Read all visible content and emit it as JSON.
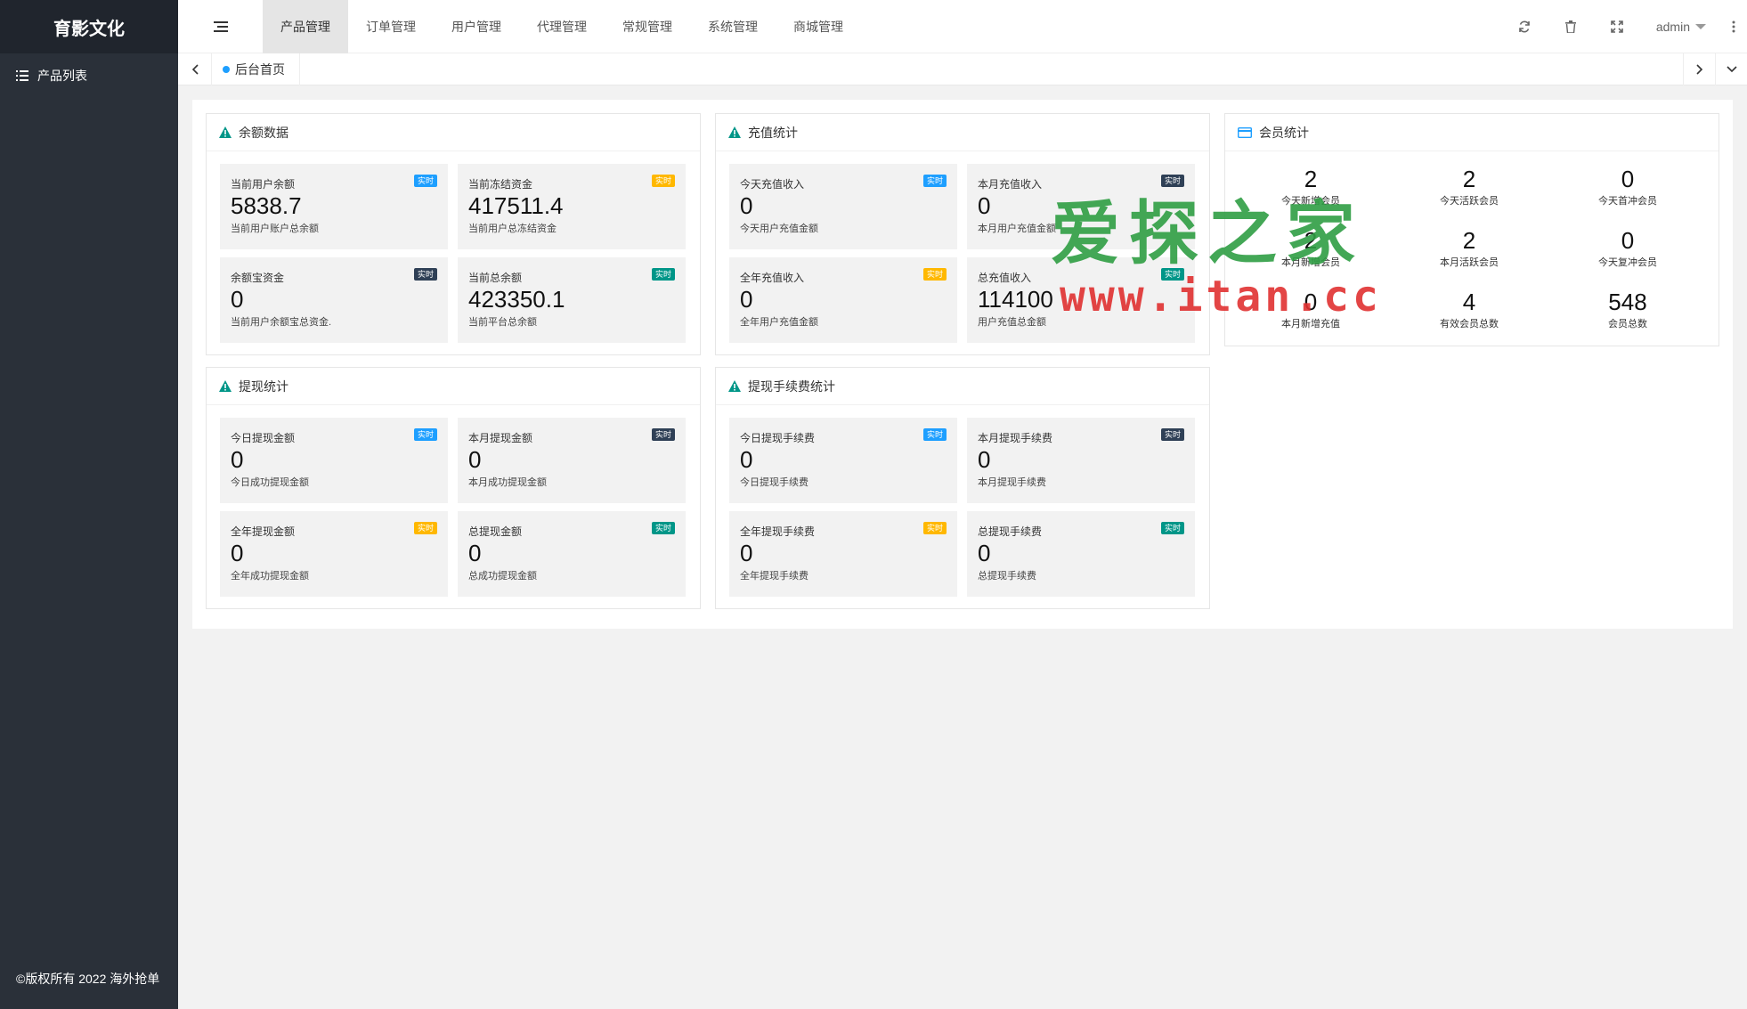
{
  "app": {
    "title": "育影文化",
    "copyright": "©版权所有 2022 海外抢单"
  },
  "sidebar": {
    "items": [
      {
        "label": "产品列表",
        "icon": "list-icon"
      }
    ]
  },
  "header": {
    "nav": [
      {
        "label": "产品管理",
        "active": true
      },
      {
        "label": "订单管理",
        "active": false
      },
      {
        "label": "用户管理",
        "active": false
      },
      {
        "label": "代理管理",
        "active": false
      },
      {
        "label": "常规管理",
        "active": false
      },
      {
        "label": "系统管理",
        "active": false
      },
      {
        "label": "商城管理",
        "active": false
      }
    ],
    "user": "admin"
  },
  "tabs": {
    "home": "后台首页"
  },
  "balance": {
    "title": "余额数据",
    "cards": [
      {
        "title": "当前用户余额",
        "badge": "实时",
        "badge_color": "#1e9fff",
        "value": "5838.7",
        "sub": "当前用户账户总余额"
      },
      {
        "title": "当前冻结资金",
        "badge": "实时",
        "badge_color": "#ffb800",
        "value": "417511.4",
        "sub": "当前用户总冻结资金"
      },
      {
        "title": "余额宝资金",
        "badge": "实时",
        "badge_color": "#2f4056",
        "value": "0",
        "sub": "当前用户余额宝总资金."
      },
      {
        "title": "当前总余额",
        "badge": "实时",
        "badge_color": "#009688",
        "value": "423350.1",
        "sub": "当前平台总余额"
      }
    ]
  },
  "recharge": {
    "title": "充值统计",
    "cards": [
      {
        "title": "今天充值收入",
        "badge": "实时",
        "badge_color": "#1e9fff",
        "value": "0",
        "sub": "今天用户充值金额"
      },
      {
        "title": "本月充值收入",
        "badge": "实时",
        "badge_color": "#2f4056",
        "value": "0",
        "sub": "本月用户充值金额"
      },
      {
        "title": "全年充值收入",
        "badge": "实时",
        "badge_color": "#ffb800",
        "value": "0",
        "sub": "全年用户充值金额"
      },
      {
        "title": "总充值收入",
        "badge": "实时",
        "badge_color": "#009688",
        "value": "114100",
        "sub": "用户充值总金额"
      }
    ]
  },
  "members": {
    "title": "会员统计",
    "items": [
      {
        "value": "2",
        "label": "今天新增会员"
      },
      {
        "value": "2",
        "label": "今天活跃会员"
      },
      {
        "value": "0",
        "label": "今天首冲会员"
      },
      {
        "value": "2",
        "label": "本月新增会员"
      },
      {
        "value": "2",
        "label": "本月活跃会员"
      },
      {
        "value": "0",
        "label": "今天复冲会员"
      },
      {
        "value": "0",
        "label": "本月新增充值"
      },
      {
        "value": "4",
        "label": "有效会员总数"
      },
      {
        "value": "548",
        "label": "会员总数"
      }
    ]
  },
  "withdraw": {
    "title": "提现统计",
    "cards": [
      {
        "title": "今日提现金额",
        "badge": "实时",
        "badge_color": "#1e9fff",
        "value": "0",
        "sub": "今日成功提现金额"
      },
      {
        "title": "本月提现金额",
        "badge": "实时",
        "badge_color": "#2f4056",
        "value": "0",
        "sub": "本月成功提现金额"
      },
      {
        "title": "全年提现金额",
        "badge": "实时",
        "badge_color": "#ffb800",
        "value": "0",
        "sub": "全年成功提现金额"
      },
      {
        "title": "总提现金额",
        "badge": "实时",
        "badge_color": "#009688",
        "value": "0",
        "sub": "总成功提现金额"
      }
    ]
  },
  "fee": {
    "title": "提现手续费统计",
    "cards": [
      {
        "title": "今日提现手续费",
        "badge": "实时",
        "badge_color": "#1e9fff",
        "value": "0",
        "sub": "今日提现手续费"
      },
      {
        "title": "本月提现手续费",
        "badge": "实时",
        "badge_color": "#2f4056",
        "value": "0",
        "sub": "本月提现手续费"
      },
      {
        "title": "全年提现手续费",
        "badge": "实时",
        "badge_color": "#ffb800",
        "value": "0",
        "sub": "全年提现手续费"
      },
      {
        "title": "总提现手续费",
        "badge": "实时",
        "badge_color": "#009688",
        "value": "0",
        "sub": "总提现手续费"
      }
    ]
  },
  "watermark": {
    "line1": "爱探之家",
    "line2": "www.itan.cc"
  }
}
